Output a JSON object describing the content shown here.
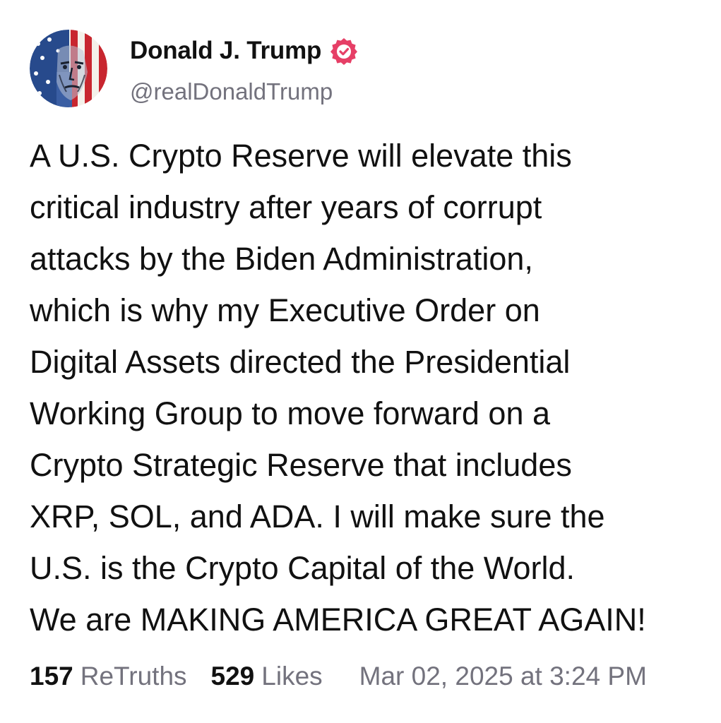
{
  "author": {
    "display_name": "Donald J. Trump",
    "handle": "@realDonaldTrump",
    "verified": true,
    "verified_badge_color": "#e63f66",
    "avatar_icon": "american-flag-portrait-avatar"
  },
  "post": {
    "lines": [
      "A U.S. Crypto Reserve will elevate this",
      "critical industry after years of corrupt",
      "attacks by the Biden Administration,",
      "which is why my Executive Order on",
      "Digital Assets directed the Presidential",
      "Working Group to move forward on a",
      "Crypto Strategic Reserve that includes",
      "XRP, SOL, and ADA. I will make sure the",
      "U.S. is the Crypto Capital of the World.",
      "We are MAKING AMERICA GREAT AGAIN!"
    ]
  },
  "stats": {
    "retruths_count": "157",
    "retruths_label": "ReTruths",
    "likes_count": "529",
    "likes_label": "Likes",
    "timestamp": "Mar 02, 2025 at 3:24 PM"
  },
  "colors": {
    "text": "#111111",
    "muted": "#73727d",
    "background": "#ffffff"
  }
}
